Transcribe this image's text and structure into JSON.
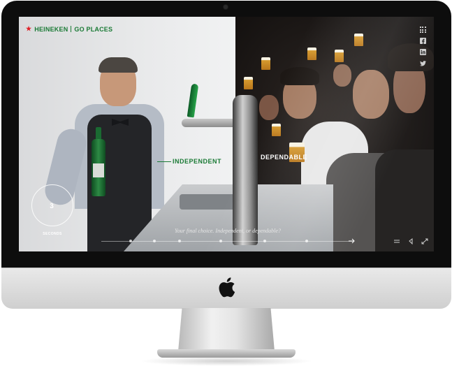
{
  "logo": {
    "brand": "HEINEKEN",
    "tagline": "GO PLACES",
    "star_color": "#e01f26",
    "brand_color": "#1a7a35"
  },
  "choices": {
    "left": "INDEPENDENT",
    "right": "DEPENDABLE"
  },
  "timer": {
    "seconds": "3",
    "label": "SECONDS"
  },
  "question": "Your final choice. Independent, or dependable?",
  "social_icons": [
    "grid-icon",
    "facebook-icon",
    "linkedin-icon",
    "twitter-icon"
  ],
  "controls": [
    "menu-icon",
    "volume-icon",
    "fullscreen-icon"
  ]
}
